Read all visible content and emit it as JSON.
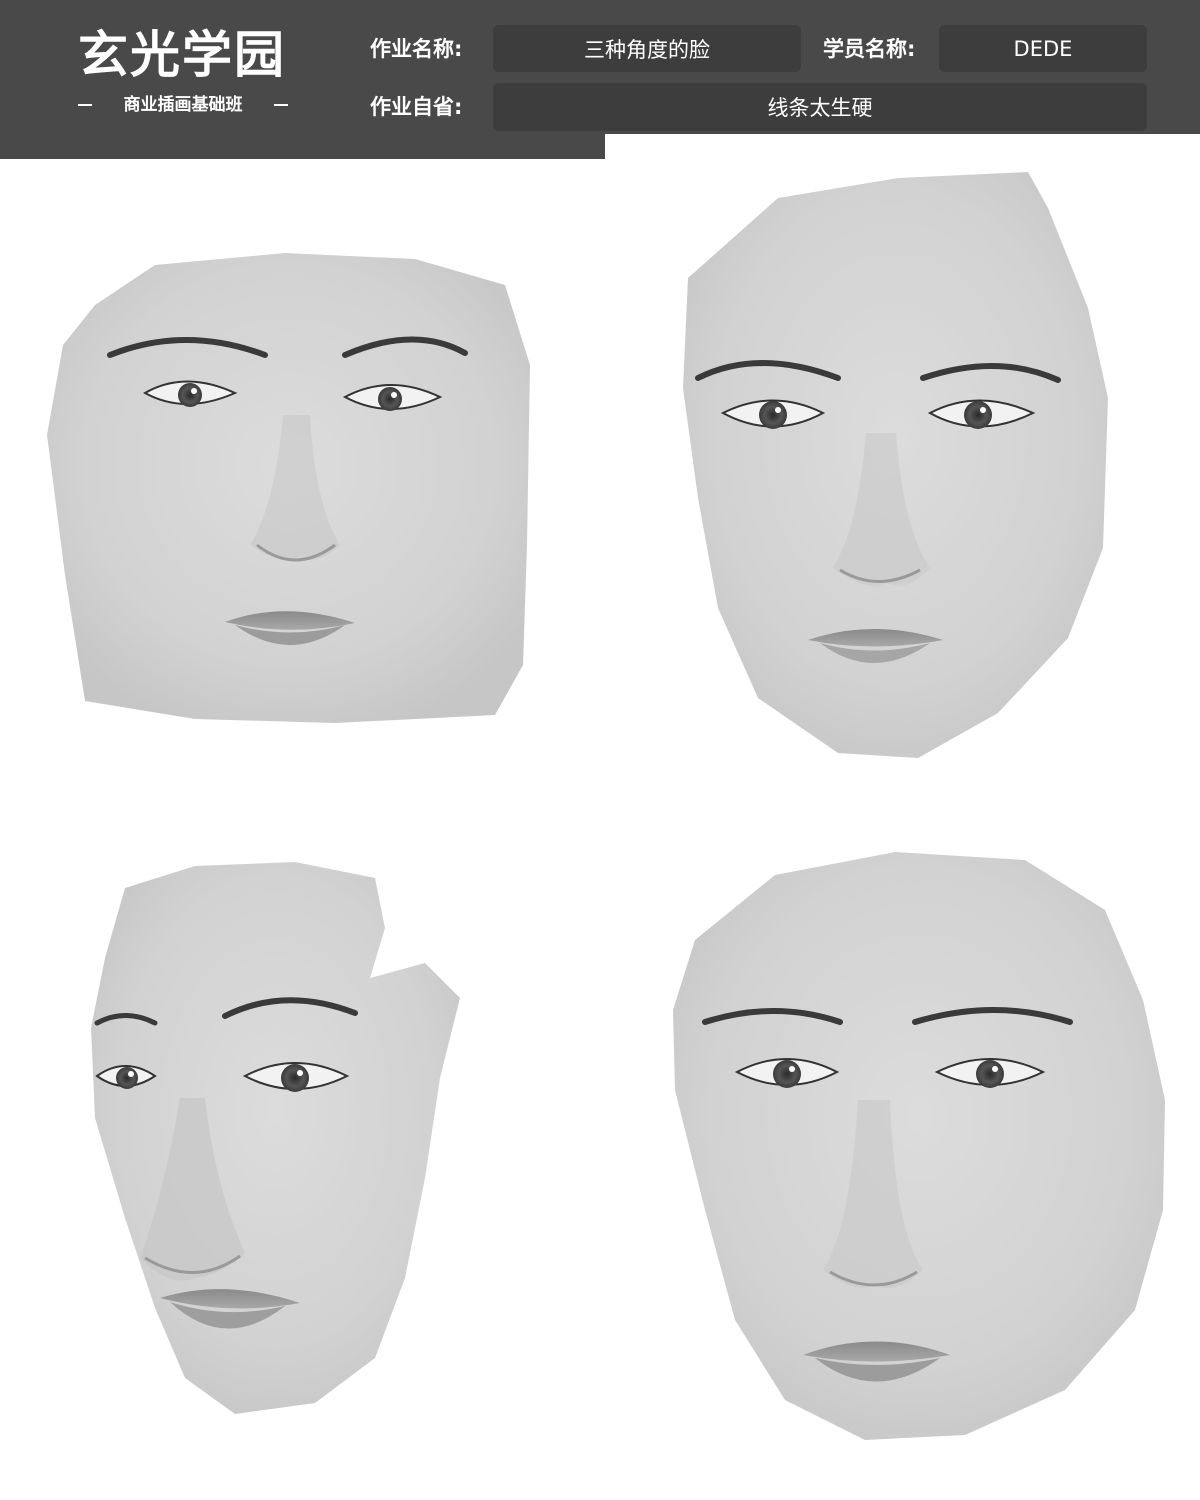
{
  "header": {
    "brand": {
      "title": "玄光学园",
      "subtitle": "商业插画基础班"
    },
    "fields": {
      "assignment_name_label": "作业名称:",
      "assignment_name_value": "三种角度的脸",
      "student_name_label": "学员名称:",
      "student_name_value": "DEDE",
      "self_review_label": "作业自省:",
      "self_review_value": "线条太生硬"
    }
  },
  "colors": {
    "header_bg": "#4a4949",
    "field_bg": "#3e3d3d",
    "text": "#ffffff",
    "canvas": "#ffffff",
    "skin": "#d4d4d4"
  },
  "artwork": {
    "faces": [
      {
        "view": "front"
      },
      {
        "view": "front"
      },
      {
        "view": "three-quarter"
      },
      {
        "view": "front"
      }
    ]
  }
}
